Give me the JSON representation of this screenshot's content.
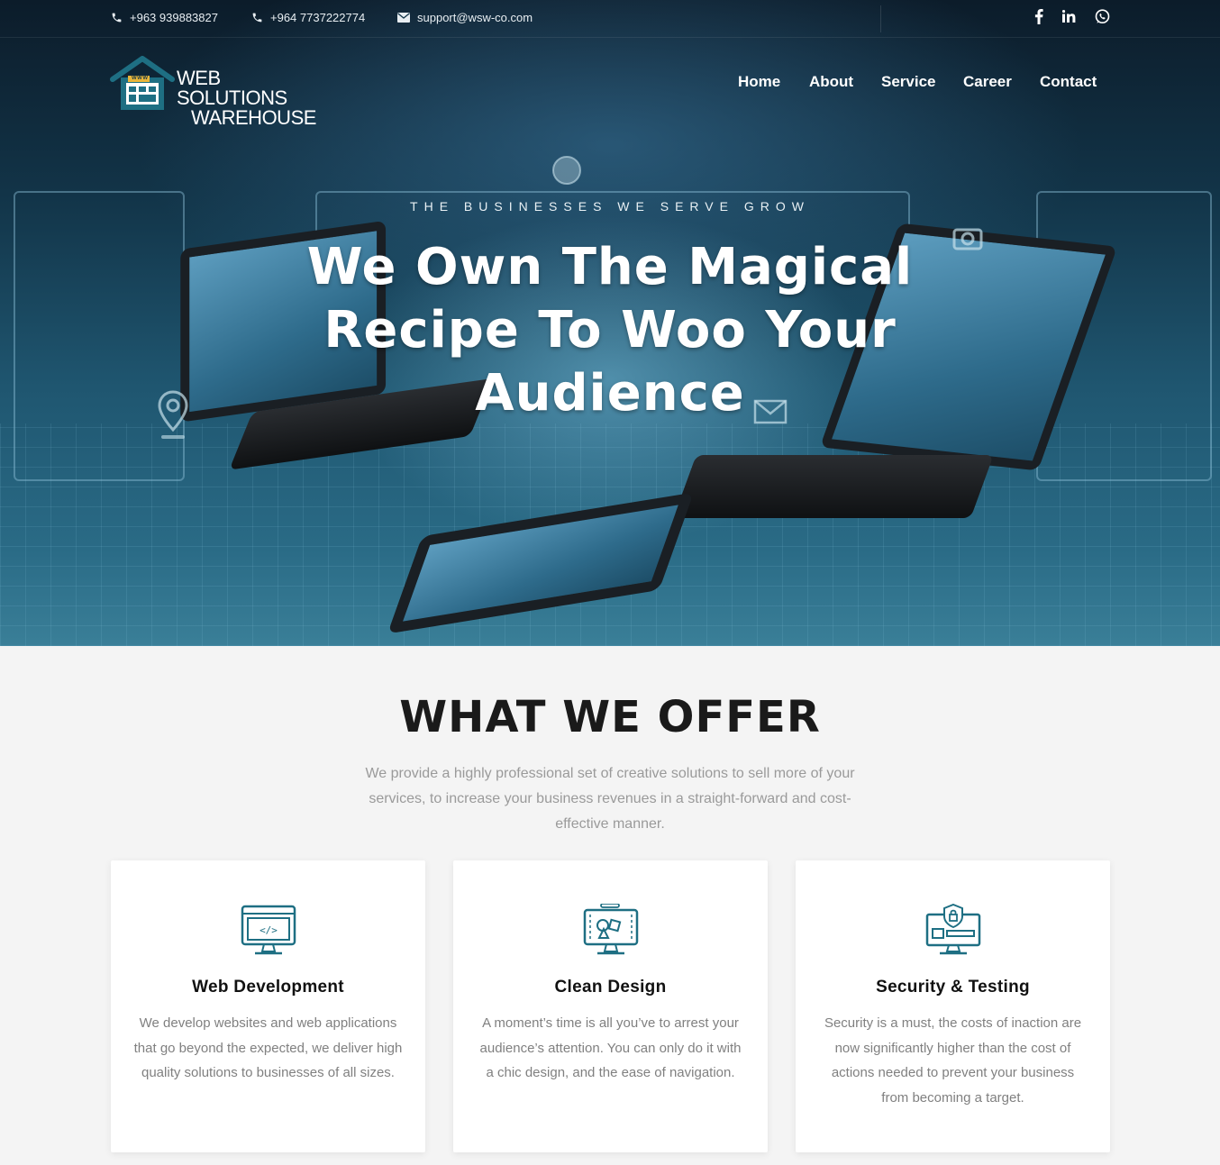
{
  "topbar": {
    "phone1": "+963 939883827",
    "phone2": "+964 7737222774",
    "email": "support@wsw-co.com",
    "social": [
      "facebook-icon",
      "linkedin-icon",
      "whatsapp-icon"
    ]
  },
  "logo": {
    "badge": "WWW",
    "line1": "WEB SOLUTIONS",
    "line2": "WAREHOUSE"
  },
  "nav": {
    "items": [
      "Home",
      "About",
      "Service",
      "Career",
      "Contact"
    ]
  },
  "hero": {
    "eyebrow": "THE BUSINESSES WE SERVE GROW",
    "title": "We Own The Magical Recipe To Woo Your Audience"
  },
  "offer": {
    "title": "WHAT WE OFFER",
    "subtitle": "We provide a highly professional set of creative solutions to sell more of your services, to increase your business revenues in a straight-forward and cost-effective manner.",
    "cards": [
      {
        "icon": "code-monitor-icon",
        "title": "Web Development",
        "text": "We develop websites and web applications that go beyond the expected, we deliver high quality solutions to businesses of all sizes."
      },
      {
        "icon": "design-monitor-icon",
        "title": "Clean Design",
        "text": "A moment’s time is all you’ve to arrest your audience’s attention. You can only do it with a chic design, and the ease of navigation."
      },
      {
        "icon": "security-monitor-icon",
        "title": "Security & Testing",
        "text": "Security is a must, the costs of inaction are now significantly higher than the cost of actions needed to prevent your business from becoming a target."
      }
    ]
  },
  "colors": {
    "accent": "#1e6f83",
    "gold": "#e8b53a",
    "hero_dark": "#0c1c2a"
  }
}
